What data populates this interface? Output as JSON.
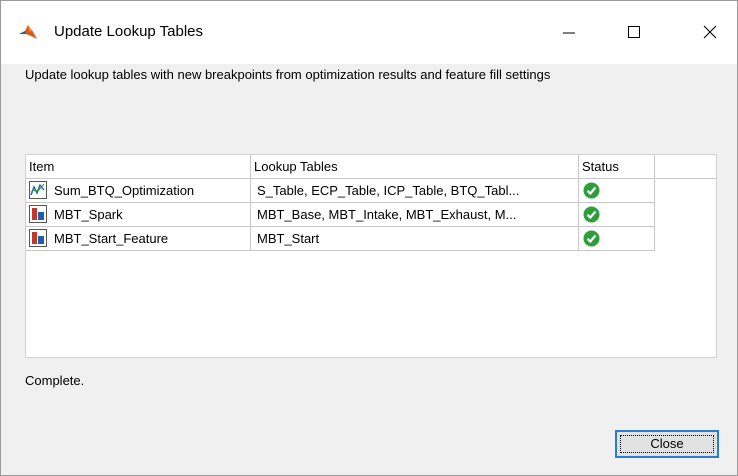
{
  "window": {
    "title": "Update Lookup Tables",
    "controls": {
      "minimize": "minimize-icon",
      "maximize": "maximize-icon",
      "close": "close-icon"
    }
  },
  "description": "Update lookup tables with new breakpoints from optimization results and feature fill settings",
  "table": {
    "columns": [
      "Item",
      "Lookup Tables",
      "Status"
    ],
    "rows": [
      {
        "icon": "optimization-icon",
        "item": "Sum_BTQ_Optimization",
        "lookup": "S_Table, ECP_Table, ICP_Table, BTQ_Tabl...",
        "status": "complete-check-icon"
      },
      {
        "icon": "feature-icon",
        "item": "MBT_Spark",
        "lookup": "MBT_Base, MBT_Intake, MBT_Exhaust, M...",
        "status": "complete-check-icon"
      },
      {
        "icon": "feature-icon",
        "item": "MBT_Start_Feature",
        "lookup": "MBT_Start",
        "status": "complete-check-icon"
      }
    ]
  },
  "status_message": "Complete.",
  "buttons": {
    "close": "Close"
  },
  "colors": {
    "accent": "#2a7cd6",
    "ok_green": "#2e9e3a"
  }
}
